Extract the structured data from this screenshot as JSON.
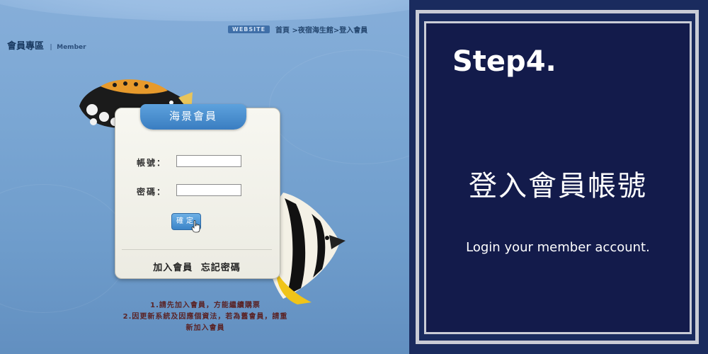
{
  "breadcrumb": {
    "badge": "WEBSITE",
    "path": "首頁 >夜宿海生館>登入會員"
  },
  "section": {
    "title": "會員專區",
    "separator": "|",
    "subtitle": "Member"
  },
  "login_card": {
    "tab_title": "海景會員",
    "account_label": "帳號：",
    "account_value": "",
    "password_label": "密碼：",
    "password_value": "",
    "ok_label": "確定",
    "join_link": "加入會員",
    "forgot_link": "忘記密碼"
  },
  "notes": {
    "line1": "1.請先加入會員，方能繼續購票",
    "line2": "2.因更新系統及因應個資法，若為舊會員，請重",
    "line3": "新加入會員"
  },
  "instruction": {
    "step": "Step4.",
    "title": "登入會員帳號",
    "subtitle": "Login your member account."
  },
  "colors": {
    "panel_bg": "#131b4b",
    "frame": "#c9ccd6",
    "tab_blue": "#3a7dc1",
    "sea_blue": "#7aa6d3"
  }
}
